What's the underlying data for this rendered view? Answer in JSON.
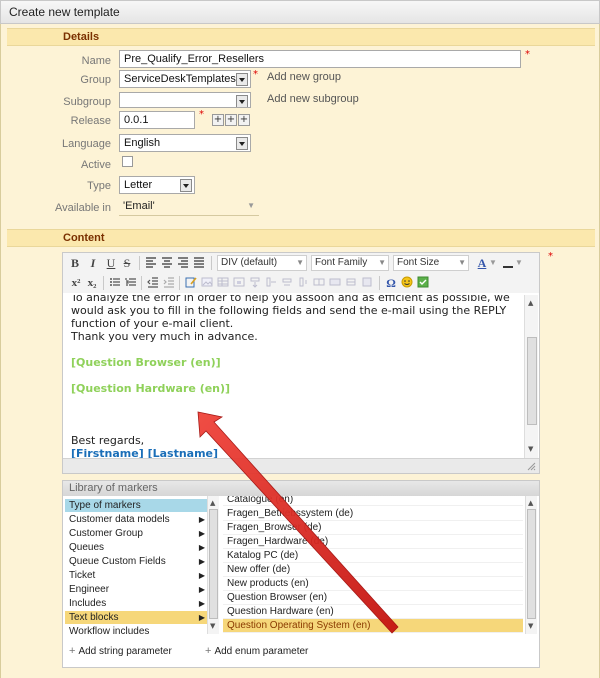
{
  "window": {
    "title": "Create new template"
  },
  "details": {
    "section_title": "Details",
    "name": {
      "label": "Name",
      "value": "Pre_Qualify_Error_Resellers"
    },
    "group": {
      "label": "Group",
      "value": "ServiceDeskTemplates",
      "add_link": "Add new group"
    },
    "subgroup": {
      "label": "Subgroup",
      "value": "",
      "add_link": "Add new subgroup"
    },
    "release": {
      "label": "Release",
      "value": "0.0.1"
    },
    "language": {
      "label": "Language",
      "value": "English"
    },
    "active": {
      "label": "Active",
      "checked": false
    },
    "type": {
      "label": "Type",
      "value": "Letter"
    },
    "available_in": {
      "label": "Available in",
      "value": "'Email'"
    },
    "required_mark": "*"
  },
  "content": {
    "section_title": "Content",
    "toolbar": {
      "bold": "B",
      "italic": "I",
      "underline": "U",
      "strike": "S",
      "block_format": "DIV (default)",
      "font_family": "Font Family",
      "font_size": "Font Size",
      "superscript": "x²",
      "subscript": "x₂",
      "font_color": "A"
    },
    "body": {
      "paragraph": "To analyze the error in order to help you assoon and as efficient as possible, we would ask you to fill in the following fields and send the e-mail using the REPLY function of your e-mail client.",
      "thanks": "Thank you very much in advance.",
      "marker_browser": "[Question Browser (en)]",
      "marker_hardware": "[Question Hardware (en)]",
      "regards": "Best regards,",
      "signature": "[Firstname] [Lastname]"
    }
  },
  "library": {
    "title": "Library of markers",
    "types": [
      {
        "label": "Type of markers",
        "has_children": false
      },
      {
        "label": "Customer data models",
        "has_children": true
      },
      {
        "label": "Customer Group",
        "has_children": true
      },
      {
        "label": "Queues",
        "has_children": true
      },
      {
        "label": "Queue Custom Fields",
        "has_children": true
      },
      {
        "label": "Ticket",
        "has_children": true
      },
      {
        "label": "Engineer",
        "has_children": true
      },
      {
        "label": "Includes",
        "has_children": true
      },
      {
        "label": "Text blocks",
        "has_children": true
      },
      {
        "label": "Workflow includes",
        "has_children": false
      }
    ],
    "markers": [
      "Catalogue (en)",
      "Fragen_Betriebssystem (de)",
      "Fragen_Browser (de)",
      "Fragen_Hardware (de)",
      "Katalog PC (de)",
      "New offer (de)",
      "New products (en)",
      "Question Browser (en)",
      "Question Hardware (en)",
      "Question Operating System (en)"
    ],
    "add_string_param": "Add string parameter",
    "add_enum_param": "Add enum parameter"
  },
  "colors": {
    "panel_bg": "#fdf3d6",
    "section_text": "#7a3000",
    "marker_green": "#8fd15a",
    "marker_blue": "#1a6eb8",
    "selected_type": "#a8d8e8",
    "selected_marker": "#f6d77a",
    "arrow": "#e8201a"
  }
}
